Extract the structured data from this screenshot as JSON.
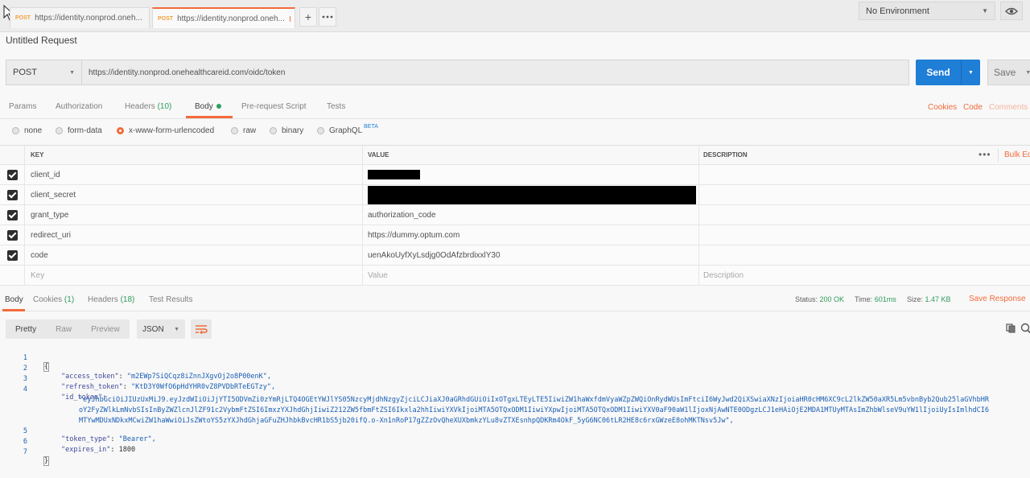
{
  "tabs": [
    {
      "method": "POST",
      "url": "https://identity.nonprod.oneh...",
      "unsaved": true,
      "active": false
    },
    {
      "method": "POST",
      "url": "https://identity.nonprod.oneh...",
      "unsaved": true,
      "active": true
    }
  ],
  "tab_actions": {
    "add_icon": "plus-icon",
    "more_icon": "more-icon"
  },
  "environment": {
    "selected": "No Environment"
  },
  "request": {
    "name": "Untitled Request",
    "method": "POST",
    "url": "https://identity.nonprod.onehealthcareid.com/oidc/token",
    "send_label": "Send",
    "save_label": "Save"
  },
  "request_tabs": [
    {
      "label": "Params"
    },
    {
      "label": "Authorization"
    },
    {
      "label": "Headers",
      "count": "(10)"
    },
    {
      "label": "Body",
      "active": true
    },
    {
      "label": "Pre-request Script"
    },
    {
      "label": "Tests"
    }
  ],
  "right_links": {
    "cookies": "Cookies",
    "code": "Code",
    "comments": "Comments"
  },
  "body_types": [
    {
      "label": "none"
    },
    {
      "label": "form-data"
    },
    {
      "label": "x-www-form-urlencoded",
      "selected": true
    },
    {
      "label": "raw"
    },
    {
      "label": "binary"
    },
    {
      "label": "GraphQL",
      "badge": "BETA"
    }
  ],
  "kv_table": {
    "headers": {
      "key": "KEY",
      "value": "VALUE",
      "description": "DESCRIPTION"
    },
    "bulk_edit": "Bulk Ed",
    "rows": [
      {
        "key": "client_id",
        "value": "",
        "redacted": true
      },
      {
        "key": "client_secret",
        "value": "",
        "redacted": true
      },
      {
        "key": "grant_type",
        "value": "authorization_code"
      },
      {
        "key": "redirect_uri",
        "value": "https://dummy.optum.com"
      },
      {
        "key": "code",
        "value": "uenAkoUyfXyLsdjg0OdAfzbrdixxlY30"
      }
    ],
    "placeholders": {
      "key": "Key",
      "value": "Value",
      "description": "Description"
    }
  },
  "response_tabs": [
    {
      "label": "Body",
      "active": true
    },
    {
      "label": "Cookies",
      "count": "(1)"
    },
    {
      "label": "Headers",
      "count": "(18)"
    },
    {
      "label": "Test Results"
    }
  ],
  "response_meta": {
    "status_label": "Status:",
    "status": "200 OK",
    "time_label": "Time:",
    "time": "601ms",
    "size_label": "Size:",
    "size": "1.47 KB",
    "save_response": "Save Response"
  },
  "response_view": {
    "modes": [
      "Pretty",
      "Raw",
      "Preview"
    ],
    "active_mode": "Pretty",
    "format": "JSON"
  },
  "response_lines": [
    {
      "n": "1",
      "text": "{"
    },
    {
      "n": "2",
      "key": "\"access_token\"",
      "val": "\"m2EWp7SiQCqz8iZnnJXgvOj2o8P00enK\","
    },
    {
      "n": "3",
      "key": "\"refresh_token\"",
      "val": "\"KtD3Y0WfO6pHdYHR0vZ8PVDbRTeEGTzy\","
    },
    {
      "n": "4",
      "key": "\"id_token\"",
      "val": ""
    },
    {
      "n": "",
      "cont": "\"eyJhbGciOiJIUzUxMiJ9.eyJzdWIiOiJjYTI5ODVmZi0zYmRjLTQ4OGEtYWJlYS05NzcyMjdhNzgyZjciLCJiaXJ0aGRhdGUiOiIxOTgxLTEyLTE5IiwiZW1haWxfdmVyaWZpZWQiOnRydWUsImFtciI6WyJwd2QiXSwiaXNzIjoiaHR0cHM6XC9cL2lkZW50aXR5Lm5vbnByb2Qub25laGVhbHR"
    },
    {
      "n": "",
      "cont": "oY2FyZWlkLmNvbSIsInByZWZlcnJlZF91c2VybmFtZSI6ImxzYXJhdGhjIiwiZ212ZW5fbmFtZSI6Ikxla2hhIiwiYXVkIjoiMTA5OTQxODM1IiwiYXpwIjoiMTA5OTQxODM1IiwiYXV0aF90aW1lIjoxNjAwNTE0ODgzLCJ1eHAiOjE2MDA1MTUyMTAsImZhbWlseV9uYW1lIjoiUyIsImlhdCI6"
    },
    {
      "n": "",
      "cont": "MTYwMDUxNDkxMCwiZW1haWwiOiJsZWtoYS5zYXJhdGhjaGFuZHJhbkBvcHR1bS5jb20ifQ.o-Xn1nRoP17gZZzOvQheXUXbmkzYLu8vZTXEsnhpQDKRm4OkF_5yG6NC06tLR2HE8c6rxGWzeE8ohMKTNsv5Jw\","
    },
    {
      "n": "5",
      "key": "\"token_type\"",
      "val": "\"Bearer\","
    },
    {
      "n": "6",
      "key": "\"expires_in\"",
      "val": "1800"
    },
    {
      "n": "7",
      "text": "}"
    }
  ],
  "colors": {
    "accent": "#f26b3a",
    "send": "#1f7ed6",
    "success": "#2e9c5c"
  }
}
